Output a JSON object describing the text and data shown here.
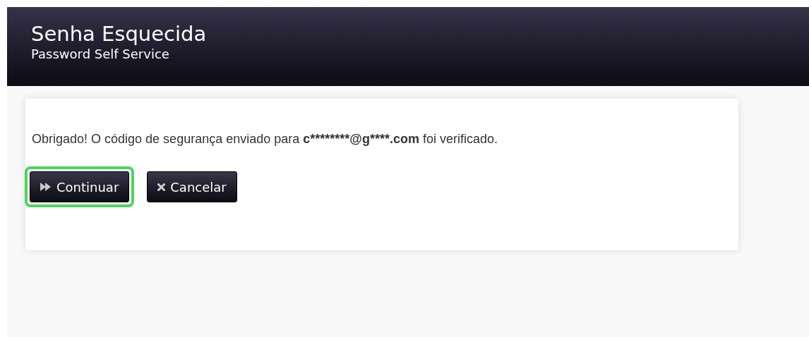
{
  "header": {
    "title": "Senha Esquecida",
    "subtitle": "Password Self Service"
  },
  "message": {
    "before": "Obrigado! O código de segurança enviado para",
    "email": "c********@g****.com",
    "after": "foi verificado."
  },
  "buttons": [
    {
      "kind": "continue",
      "label": "Continuar",
      "highlighted": true
    },
    {
      "kind": "cancel",
      "label": "Cancelar",
      "highlighted": false
    }
  ]
}
